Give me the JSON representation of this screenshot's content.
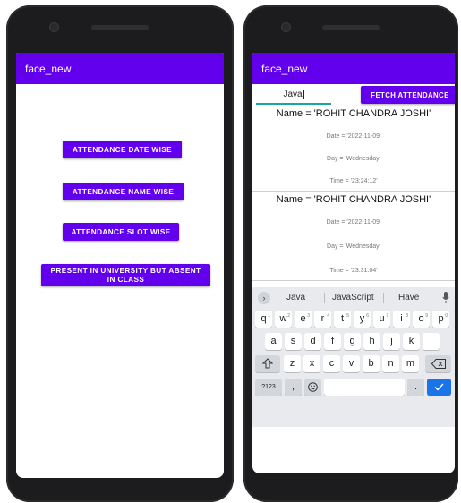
{
  "left_phone": {
    "app_title": "face_new",
    "buttons": [
      "ATTENDANCE DATE WISE",
      "ATTENDANCE NAME WISE",
      "ATTENDANCE SLOT WISE",
      "PRESENT IN UNIVERSITY BUT ABSENT IN CLASS"
    ]
  },
  "right_phone": {
    "app_title": "face_new",
    "search_value": "Java",
    "fetch_button": "FETCH ATTENDANCE",
    "records": [
      {
        "name": "Name = 'ROHIT CHANDRA JOSHI'",
        "date": "Date = '2022-11-09'",
        "day": "Day = 'Wednesday'",
        "time": "Time = '23:24:12'"
      },
      {
        "name": "Name = 'ROHIT CHANDRA JOSHI'",
        "date": "Date = '2022-11-09'",
        "day": "Day = 'Wednesday'",
        "time": "Time = '23:31:04'"
      }
    ],
    "keyboard": {
      "suggestions": [
        "Java",
        "JavaScript",
        "Have"
      ],
      "row1": [
        "q",
        "w",
        "e",
        "r",
        "t",
        "y",
        "u",
        "i",
        "o",
        "p"
      ],
      "row1_hints": [
        "1",
        "2",
        "3",
        "4",
        "5",
        "6",
        "7",
        "8",
        "9",
        "0"
      ],
      "row2": [
        "a",
        "s",
        "d",
        "f",
        "g",
        "h",
        "j",
        "k",
        "l"
      ],
      "row3": [
        "z",
        "x",
        "c",
        "v",
        "b",
        "n",
        "m"
      ],
      "symbols_key": "?123",
      "comma_key": ",",
      "period_key": "."
    }
  },
  "colors": {
    "accent": "#6200ee",
    "underline": "#1aa3a3",
    "enter": "#1a73e8"
  }
}
